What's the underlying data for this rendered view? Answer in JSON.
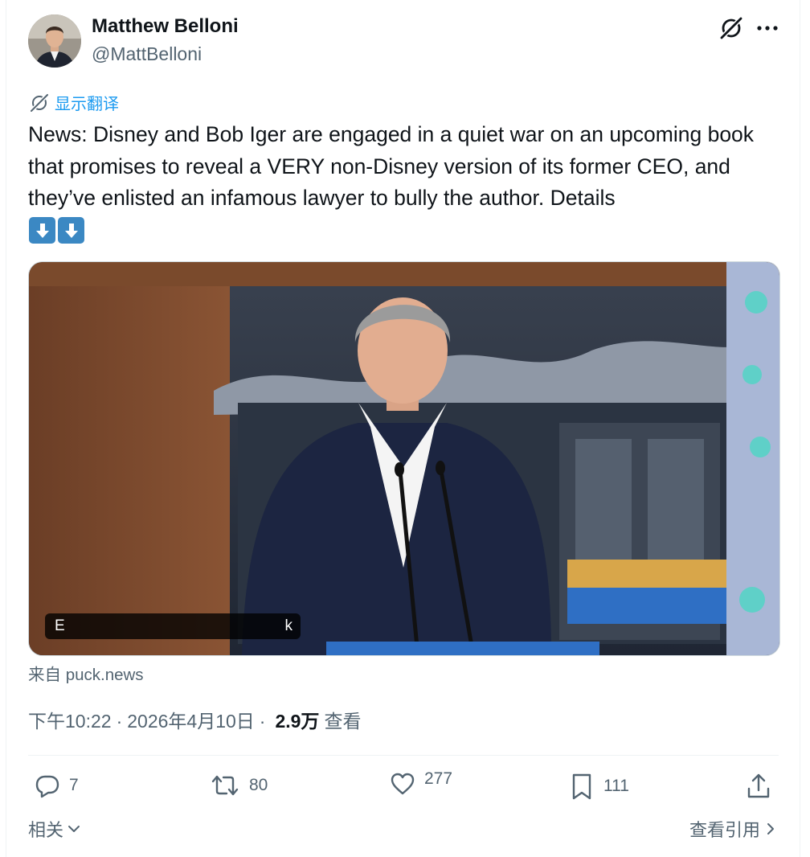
{
  "author": {
    "display_name": "Matthew Belloni",
    "handle": "@MattBelloni"
  },
  "header": {
    "grok_icon": "grok-slash-icon",
    "more_icon": "more-dots-icon"
  },
  "translate": {
    "label": "显示翻译",
    "icon": "translate-icon"
  },
  "tweet": {
    "text": "News: Disney and Bob Iger are engaged in a quiet war on an upcoming book that promises to reveal a VERY non-Disney version of its former CEO, and they’ve enlisted an infamous lawyer to bully the author. Details",
    "emojis": [
      "arrow-down-emoji",
      "arrow-down-emoji"
    ]
  },
  "media": {
    "caption_start": "E",
    "caption_end": "k"
  },
  "source": {
    "label": "来自 puck.news"
  },
  "meta": {
    "time": "下午10:22",
    "date": "2026年4月10日",
    "views_count": "2.9万",
    "views_label": "查看",
    "separator": "·"
  },
  "actions": {
    "reply_count": "7",
    "retweet_count": "80",
    "like_count": "277",
    "bookmark_count": "111"
  },
  "footer": {
    "related_label": "相关",
    "quotes_label": "查看引用"
  },
  "colors": {
    "accent": "#1d9bf0",
    "muted_text": "#536471",
    "primary_text": "#0f1419",
    "emoji_blue": "#3b88c3"
  }
}
